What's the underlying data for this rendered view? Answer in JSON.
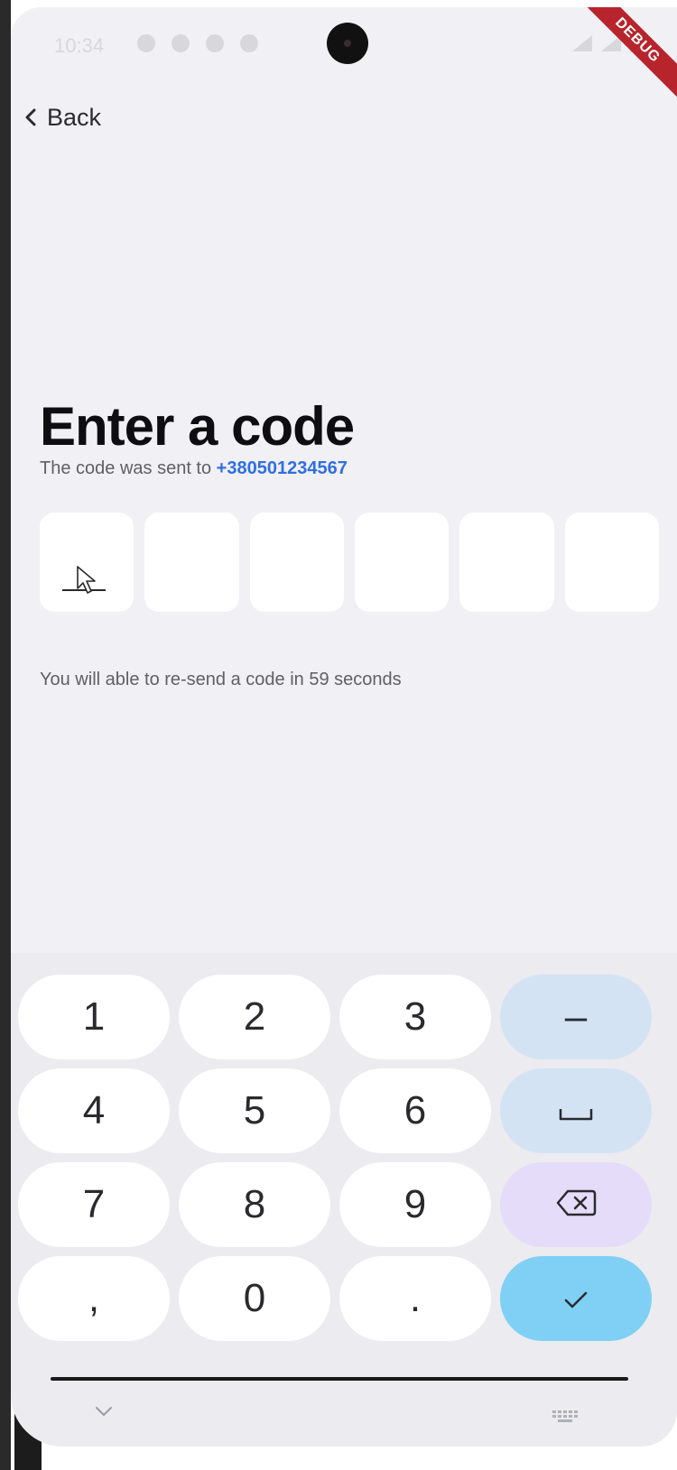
{
  "status_bar": {
    "time": "10:34"
  },
  "debug_banner": "DEBUG",
  "header": {
    "back_label": "Back"
  },
  "main": {
    "title": "Enter a code",
    "subtitle_prefix": "The code was sent to",
    "phone_number": "+380501234567",
    "resend_text": "You will able to re-send a code in 59 seconds",
    "code_digits": [
      "",
      "",
      "",
      "",
      "",
      ""
    ]
  },
  "keyboard": {
    "keys": [
      "1",
      "2",
      "3",
      "–",
      "4",
      "5",
      "6",
      "␣",
      "7",
      "8",
      "9",
      "⌫",
      ",",
      "0",
      ".",
      "✓"
    ]
  },
  "colors": {
    "background": "#f1f0f5",
    "accent_blue": "#2f6fe0",
    "key_blue": "#d3e3f4",
    "key_purple": "#e4dcf8",
    "key_done": "#7fd0f4"
  }
}
